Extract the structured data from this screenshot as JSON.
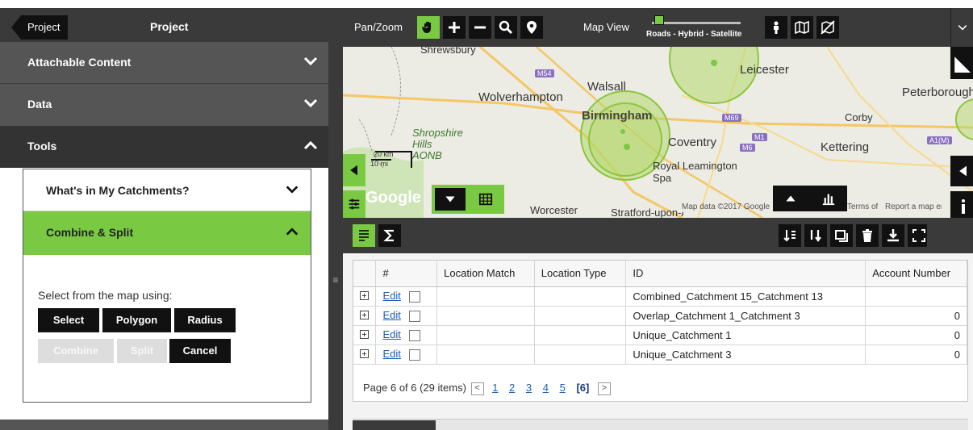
{
  "sidebar": {
    "back_label": "Project",
    "title": "Project",
    "sections": [
      {
        "label": "Attachable Content"
      },
      {
        "label": "Data"
      },
      {
        "label": "Tools"
      }
    ],
    "tools": {
      "items": [
        {
          "label": "What's in My Catchments?"
        },
        {
          "label": "Combine & Split"
        }
      ],
      "select_label": "Select from the map using:",
      "buttons": {
        "select": "Select",
        "polygon": "Polygon",
        "radius": "Radius",
        "combine": "Combine",
        "split": "Split",
        "cancel": "Cancel"
      }
    }
  },
  "toolbar": {
    "panzoom_label": "Pan/Zoom",
    "mapview_label": "Map View",
    "mapview_slider_label": "Roads - Hybrid - Satellite"
  },
  "map": {
    "places": [
      "Shrewsbury",
      "Walsall",
      "Leicester",
      "Peterborough",
      "Wolverhampton",
      "Birmingham",
      "Corby",
      "Shropshire Hills AONB",
      "Coventry",
      "Kettering",
      "Royal Leamington Spa",
      "Worcester",
      "Stratford-upon-Avon"
    ],
    "roads": [
      "M54",
      "M69",
      "M1",
      "M6",
      "A1(M)"
    ],
    "scale_km": "20 km",
    "scale_mi": "10 mi",
    "google": "Google",
    "attribution": "Map data ©2017 Google",
    "terms": "Terms of Use",
    "report": "Report a map error"
  },
  "grid": {
    "columns": [
      "",
      "#",
      "Location Match",
      "Location Type",
      "ID",
      "Account Number"
    ],
    "rows": [
      {
        "edit": "Edit",
        "location_match": "",
        "location_type": "",
        "id": "Combined_Catchment 15_Catchment 13",
        "account": ""
      },
      {
        "edit": "Edit",
        "location_match": "",
        "location_type": "",
        "id": "Overlap_Catchment 1_Catchment 3",
        "account": "0"
      },
      {
        "edit": "Edit",
        "location_match": "",
        "location_type": "",
        "id": "Unique_Catchment 1",
        "account": "0"
      },
      {
        "edit": "Edit",
        "location_match": "",
        "location_type": "",
        "id": "Unique_Catchment 3",
        "account": "0"
      }
    ],
    "pager": {
      "summary": "Page 6 of 6 (29 items)",
      "pages": [
        "1",
        "2",
        "3",
        "4",
        "5",
        "[6]"
      ],
      "prev": "<",
      "next": ">"
    }
  },
  "colors": {
    "accent": "#7ac943",
    "dark": "#3a3a3a",
    "black": "#111111",
    "catchment_fill": "#b5d86b"
  }
}
